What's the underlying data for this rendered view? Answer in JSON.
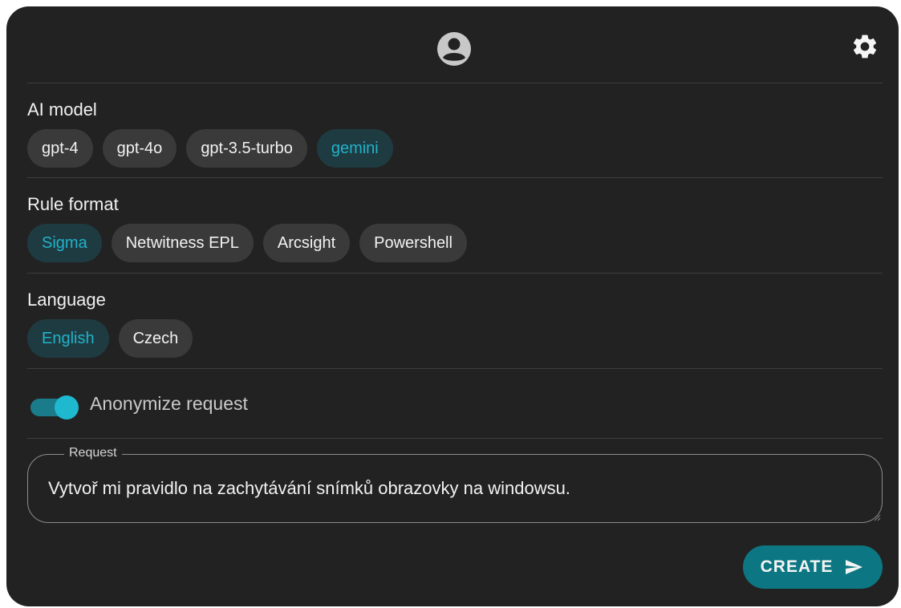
{
  "sections": {
    "ai_model": {
      "title": "AI model",
      "options": [
        "gpt-4",
        "gpt-4o",
        "gpt-3.5-turbo",
        "gemini"
      ],
      "selected": "gemini"
    },
    "rule_format": {
      "title": "Rule format",
      "options": [
        "Sigma",
        "Netwitness EPL",
        "Arcsight",
        "Powershell"
      ],
      "selected": "Sigma"
    },
    "language": {
      "title": "Language",
      "options": [
        "English",
        "Czech"
      ],
      "selected": "English"
    }
  },
  "anonymize": {
    "label": "Anonymize request",
    "enabled": true
  },
  "request": {
    "label": "Request",
    "value": "Vytvoř mi pravidlo na zachytávání snímků obrazovky na windowsu."
  },
  "create_button": {
    "label": "CREATE"
  },
  "icons": {
    "header_center": "account-circle-icon",
    "header_right": "gear-icon",
    "button": "send-icon"
  },
  "colors": {
    "panel_bg": "#222222",
    "chip_bg": "#3a3a3a",
    "chip_selected_bg": "#1f3b42",
    "accent": "#21b2c9",
    "button_bg": "#0c7782"
  }
}
